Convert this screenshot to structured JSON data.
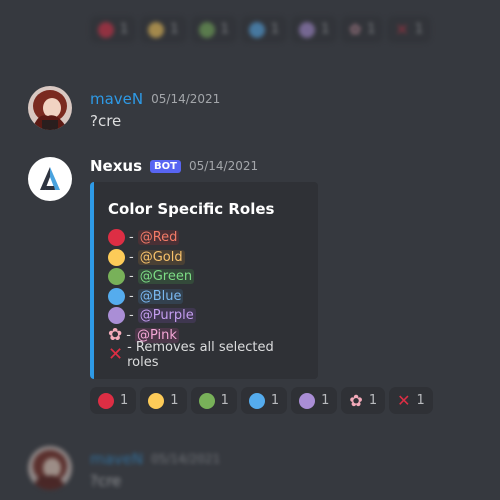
{
  "top_reactions": [
    {
      "emoji": "red-circle",
      "count": "1"
    },
    {
      "emoji": "yellow-circle",
      "count": "1"
    },
    {
      "emoji": "green-circle",
      "count": "1"
    },
    {
      "emoji": "blue-circle",
      "count": "1"
    },
    {
      "emoji": "purple-circle",
      "count": "1"
    },
    {
      "emoji": "cherry-blossom",
      "count": "1"
    },
    {
      "emoji": "cross-mark",
      "count": "1"
    }
  ],
  "message1": {
    "author": "maveN",
    "timestamp": "05/14/2021",
    "text": "?cre"
  },
  "message2": {
    "author": "Nexus",
    "badge": "BOT",
    "timestamp": "05/14/2021",
    "embed": {
      "title": "Color Specific Roles",
      "accent": "#2e9ae6",
      "roles": [
        {
          "emoji": "red-circle",
          "mention": "@Red",
          "color": "#f47b67",
          "bg": "#4a3035"
        },
        {
          "emoji": "yellow-circle",
          "mention": "@Gold",
          "color": "#f8c26b",
          "bg": "#4a4034"
        },
        {
          "emoji": "green-circle",
          "mention": "@Green",
          "color": "#7ddc85",
          "bg": "#344a3a"
        },
        {
          "emoji": "blue-circle",
          "mention": "@Blue",
          "color": "#7ab8f0",
          "bg": "#33414f"
        },
        {
          "emoji": "purple-circle",
          "mention": "@Purple",
          "color": "#c49ef0",
          "bg": "#3f3750"
        },
        {
          "emoji": "cherry-blossom",
          "mention": "@Pink",
          "color": "#f3a6d6",
          "bg": "#4b3648"
        }
      ],
      "clear_text": "- Removes all selected roles"
    },
    "reactions": [
      {
        "emoji": "red-circle",
        "count": "1"
      },
      {
        "emoji": "yellow-circle",
        "count": "1"
      },
      {
        "emoji": "green-circle",
        "count": "1"
      },
      {
        "emoji": "blue-circle",
        "count": "1"
      },
      {
        "emoji": "purple-circle",
        "count": "1"
      },
      {
        "emoji": "cherry-blossom",
        "count": "1"
      },
      {
        "emoji": "cross-mark",
        "count": "1"
      }
    ]
  },
  "message3": {
    "author": "maveN",
    "timestamp": "05/14/2021",
    "text": "?cre"
  },
  "colors": {
    "red": "#dd2e44",
    "yellow": "#fdcb58",
    "green": "#78b159",
    "blue": "#55acee",
    "purple": "#aa8ed6",
    "pink": "#f4abba"
  }
}
